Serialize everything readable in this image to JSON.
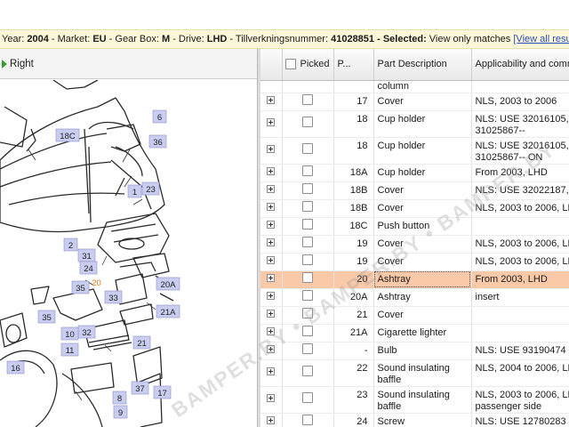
{
  "info_bar": {
    "year_label": "Year: ",
    "year": "2004",
    "market_label": " - Market: ",
    "market": "EU",
    "gearbox_label": " - Gear Box: ",
    "gearbox": "M",
    "drive_label": " - Drive: ",
    "drive": "LHD",
    "vin_label": " - Tillverkningsnummer: ",
    "vin": "41028851",
    "selected_label": " - Selected: ",
    "selected": "View only matches ",
    "view_all_link": "[View all results"
  },
  "left_toolbar": {
    "right_button": "Right"
  },
  "diagram": {
    "callouts": [
      "18B",
      "18",
      "38",
      "6",
      "18C",
      "36",
      "1",
      "23",
      "31",
      "2",
      "24",
      "35",
      "20",
      "20A",
      "33",
      "35",
      "32",
      "21A",
      "10",
      "21",
      "11",
      "16",
      "17",
      "37",
      "8",
      "9"
    ]
  },
  "grid": {
    "columns": [
      "Picked",
      "P...",
      "Part Description",
      "Applicability and comm"
    ],
    "rows": [
      {
        "pos": "",
        "desc": "column",
        "app": "",
        "partial": true
      },
      {
        "pos": "17",
        "desc": "Cover",
        "app": "NLS, 2003 to 2006"
      },
      {
        "pos": "18",
        "desc": "Cup holder",
        "app": "NLS: USE 32016105, Chassi 31025867--"
      },
      {
        "pos": "18",
        "desc": "Cup holder",
        "app": "NLS: USE 32016105, Chassi 31025867-- ON"
      },
      {
        "pos": "18A",
        "desc": "Cup holder",
        "app": "From 2003, LHD"
      },
      {
        "pos": "18B",
        "desc": "Cover",
        "app": "NLS: USE 32022187,"
      },
      {
        "pos": "18B",
        "desc": "Cover",
        "app": "NLS, 2003 to 2006, LH"
      },
      {
        "pos": "18C",
        "desc": "Push button",
        "app": ""
      },
      {
        "pos": "19",
        "desc": "Cover",
        "app": "NLS, 2003 to 2006, LH"
      },
      {
        "pos": "19",
        "desc": "Cover",
        "app": "NLS, 2003 to 2006, LH"
      },
      {
        "pos": "20",
        "desc": "Ashtray",
        "app": "From 2003, LHD",
        "selected": true
      },
      {
        "pos": "20A",
        "desc": "Ashtray",
        "app": "insert",
        "indent": true
      },
      {
        "pos": "21",
        "desc": "Cover",
        "app": ""
      },
      {
        "pos": "21A",
        "desc": "Cigarette lighter",
        "app": ""
      },
      {
        "pos": "-",
        "desc": "Bulb",
        "app": "NLS: USE 93190474 c"
      },
      {
        "pos": "22",
        "desc": "Sound insulating baffle",
        "app": "NLS, 2004 to 2006, LH"
      },
      {
        "pos": "23",
        "desc": "Sound insulating baffle",
        "app": "NLS, 2003 to 2006, LH passenger side"
      },
      {
        "pos": "24",
        "desc": "Screw",
        "app": "NLS: USE 12780283"
      }
    ]
  },
  "watermark": {
    "text": "BAMPER.BY • BAMPER.BY • BAMPER.BY"
  },
  "colors": {
    "info_bar_bg": "#fdf7d9",
    "selected_row_bg": "#f9c9a8",
    "callout_fill": "#c9cdf0",
    "link": "#2a4fb8"
  }
}
